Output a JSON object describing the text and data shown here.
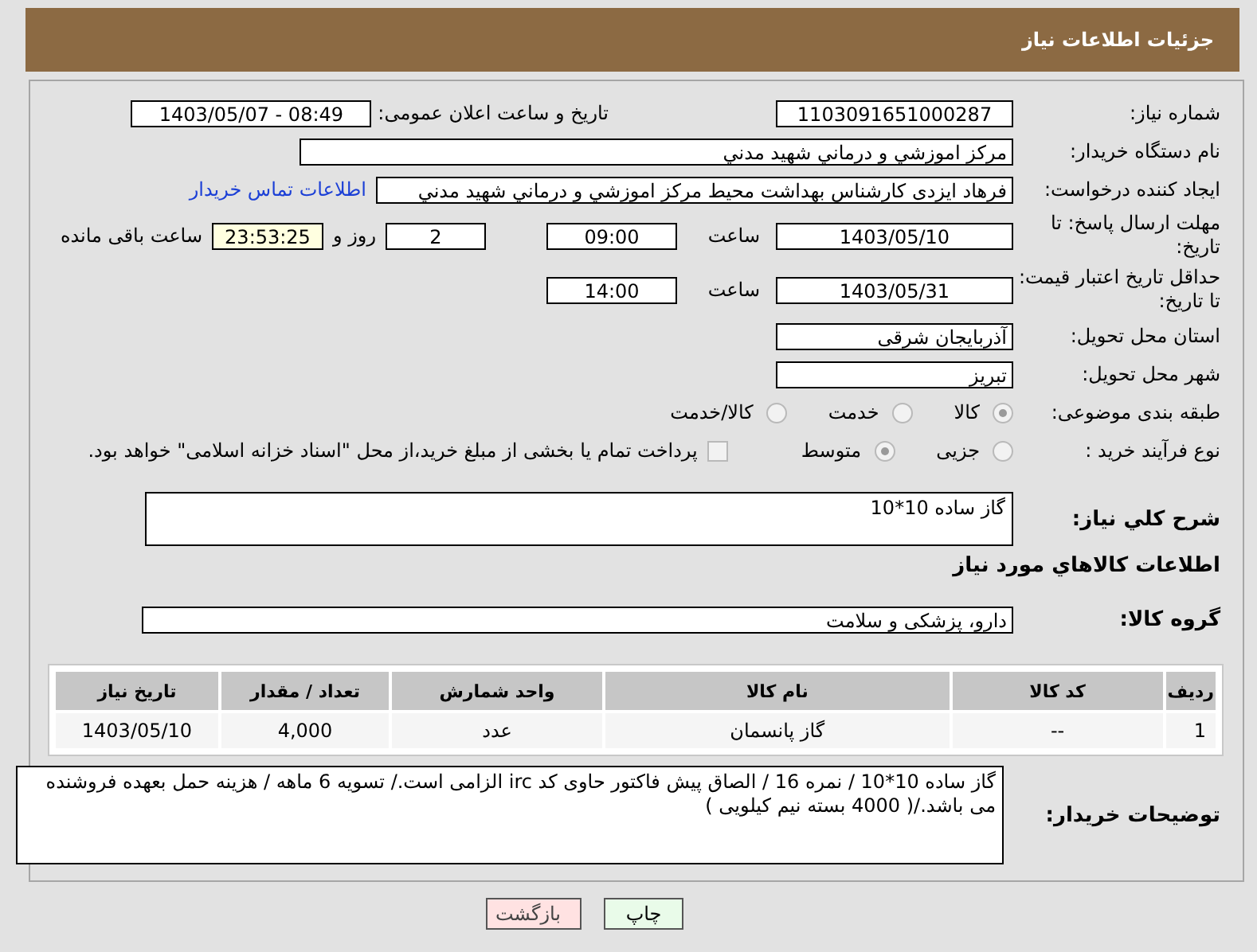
{
  "header": {
    "title": "جزئیات اطلاعات نیاز"
  },
  "need_number": {
    "label": "شماره نیاز:",
    "value": "1103091651000287"
  },
  "announce": {
    "label": "تاریخ و ساعت اعلان عمومی:",
    "value": "1403/05/07 - 08:49"
  },
  "buyer": {
    "label": "نام دستگاه خریدار:",
    "value": "مرکز اموزشي و درماني شهيد مدني"
  },
  "creator": {
    "label": "ایجاد کننده درخواست:",
    "value": "فرهاد ایزدی کارشناس بهداشت محیط مرکز اموزشي و درماني شهيد مدني",
    "link": "اطلاعات تماس خریدار"
  },
  "deadline": {
    "label": "مهلت ارسال پاسخ: تا تاریخ:",
    "date": "1403/05/10",
    "time_label": "ساعت",
    "time": "09:00",
    "days": "2",
    "days_label": "روز و",
    "remaining": "23:53:25",
    "remaining_label": "ساعت باقی مانده"
  },
  "validity": {
    "label": "حداقل تاریخ اعتبار قیمت: تا تاریخ:",
    "date": "1403/05/31",
    "time_label": "ساعت",
    "time": "14:00"
  },
  "province": {
    "label": "استان محل تحویل:",
    "value": "آذربایجان شرقی"
  },
  "city": {
    "label": "شهر محل تحویل:",
    "value": "تبریز"
  },
  "category": {
    "label": "طبقه بندی موضوعی:",
    "options": [
      {
        "label": "کالا",
        "selected": true
      },
      {
        "label": "خدمت",
        "selected": false
      },
      {
        "label": "کالا/خدمت",
        "selected": false
      }
    ]
  },
  "process": {
    "label": "نوع فرآیند خرید :",
    "options": [
      {
        "label": "جزیی",
        "selected": false
      },
      {
        "label": "متوسط",
        "selected": true
      }
    ],
    "payment": {
      "checked": false,
      "label": "پرداخت تمام یا بخشی از مبلغ خرید،از محل \"اسناد خزانه اسلامی\" خواهد بود."
    }
  },
  "description": {
    "label": "شرح کلي نياز:",
    "value": "گاز ساده 10*10"
  },
  "goods_title": "اطلاعات کالاهاي مورد نياز",
  "goods_group": {
    "label": "گروه کالا:",
    "value": "دارو، پزشکی و سلامت"
  },
  "table": {
    "columns": [
      "ردیف",
      "کد کالا",
      "نام کالا",
      "واحد شمارش",
      "تعداد / مقدار",
      "تاریخ نیاز"
    ],
    "rows": [
      [
        "1",
        "--",
        "گاز پانسمان",
        "عدد",
        "4,000",
        "1403/05/10"
      ]
    ]
  },
  "notes": {
    "label": "توضیحات خریدار:",
    "value": "گاز ساده 10*10 / نمره 16 / الصاق پیش فاکتور حاوی کد irc الزامی است./ تسویه 6 ماهه / هزینه حمل بعهده فروشنده می باشد./( 4000 بسته  نیم کیلویی )"
  },
  "buttons": [
    {
      "label": "چاپ",
      "kind": "print"
    },
    {
      "label": "بازگشت",
      "kind": "back"
    }
  ]
}
